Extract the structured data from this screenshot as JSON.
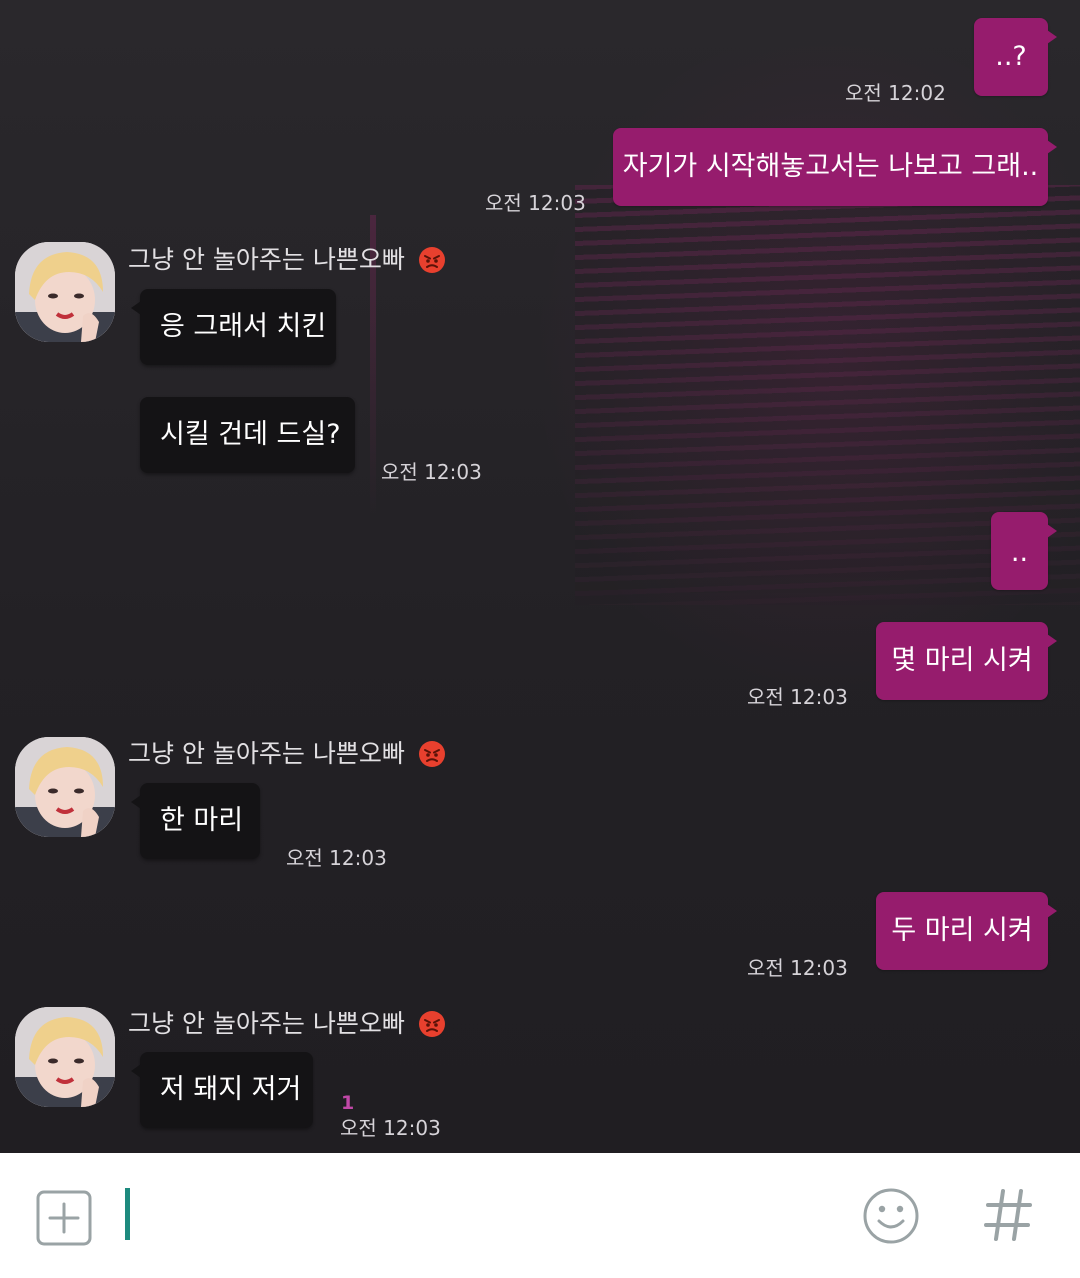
{
  "colors": {
    "outgoing_bubble": "#961c6d",
    "incoming_bubble": "#141315",
    "unread_count": "#c148a8",
    "cursor": "#1d8a7e",
    "input_bar": "#ffffff"
  },
  "contact": {
    "name": "그냥 안 놀아주는 나쁜오빠",
    "name_icon": "angry-face-icon"
  },
  "messages": [
    {
      "direction": "outgoing",
      "text": "..?",
      "time": "오전 12:02"
    },
    {
      "direction": "outgoing",
      "text": "자기가 시작해놓고서는 나보고 그래..",
      "time": "오전 12:03"
    },
    {
      "direction": "incoming",
      "text": "응 그래서 치킨",
      "time": ""
    },
    {
      "direction": "incoming",
      "text": "시킬 건데 드실?",
      "time": "오전 12:03"
    },
    {
      "direction": "outgoing",
      "text": "..",
      "time": ""
    },
    {
      "direction": "outgoing",
      "text": "몇 마리 시켜",
      "time": "오전 12:03"
    },
    {
      "direction": "incoming",
      "text": "한 마리",
      "time": "오전 12:03"
    },
    {
      "direction": "outgoing",
      "text": "두 마리 시켜",
      "time": "오전 12:03"
    },
    {
      "direction": "incoming",
      "text": "저 돼지 저거",
      "time": "오전 12:03",
      "unread": "1"
    }
  ],
  "input_bar": {
    "attach_icon": "plus-box-icon",
    "emoji_icon": "smiley-icon",
    "hashtag_icon": "hashtag-icon",
    "hashtag_glyph": "#",
    "input_value": ""
  }
}
